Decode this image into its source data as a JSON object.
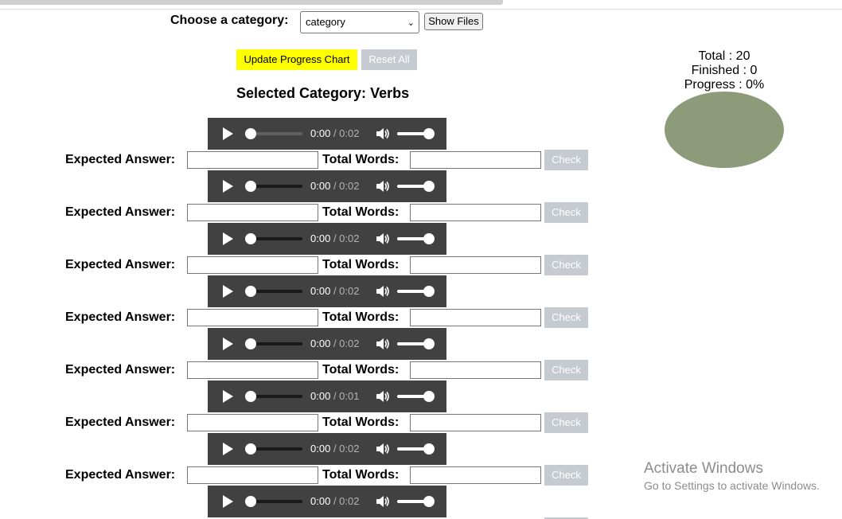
{
  "header": {
    "category_label": "Choose a category:",
    "category_select_value": "category",
    "show_files_label": "Show Files",
    "update_chart_label": "Update Progress Chart",
    "reset_all_label": "Reset All",
    "selected_category_label": "Selected Category:",
    "selected_category_value": "Verbs"
  },
  "progress": {
    "total": "Total : 20",
    "finished": "Finished : 0",
    "progress": "Progress : 0%",
    "pie_color": "#8d9b7a"
  },
  "rows": [
    {
      "current": "0:00",
      "duration": "/ 0:02",
      "answer_label": "Expected Answer:",
      "words_label": "Total Words:",
      "check_label": "Check"
    },
    {
      "current": "0:00",
      "duration": "/ 0:02",
      "answer_label": "Expected Answer:",
      "words_label": "Total Words:",
      "check_label": "Check"
    },
    {
      "current": "0:00",
      "duration": "/ 0:02",
      "answer_label": "Expected Answer:",
      "words_label": "Total Words:",
      "check_label": "Check"
    },
    {
      "current": "0:00",
      "duration": "/ 0:02",
      "answer_label": "Expected Answer:",
      "words_label": "Total Words:",
      "check_label": "Check"
    },
    {
      "current": "0:00",
      "duration": "/ 0:02",
      "answer_label": "Expected Answer:",
      "words_label": "Total Words:",
      "check_label": "Check"
    },
    {
      "current": "0:00",
      "duration": "/ 0:01",
      "answer_label": "Expected Answer:",
      "words_label": "Total Words:",
      "check_label": "Check"
    },
    {
      "current": "0:00",
      "duration": "/ 0:02",
      "answer_label": "Expected Answer:",
      "words_label": "Total Words:",
      "check_label": "Check"
    },
    {
      "current": "0:00",
      "duration": "/ 0:02"
    }
  ],
  "watermark": {
    "line1": "Activate Windows",
    "line2": "Go to Settings to activate Windows."
  },
  "colors": {
    "update_button": "#ffff00",
    "disabled_button": "#c5cbd1",
    "audio_player_bg": "#414141"
  }
}
